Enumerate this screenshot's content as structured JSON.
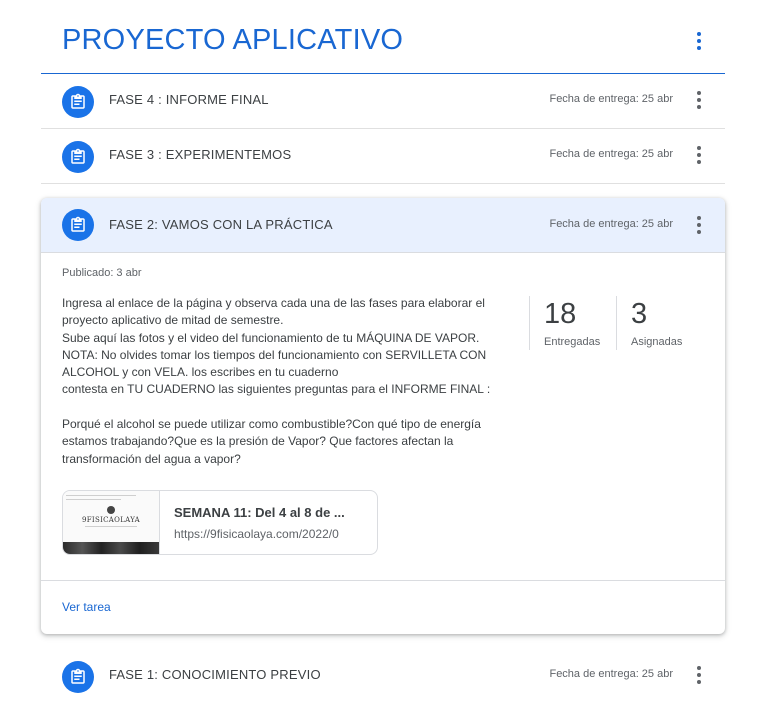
{
  "topic": {
    "title": "PROYECTO APLICATIVO"
  },
  "assignments": [
    {
      "title": "FASE 4 : INFORME FINAL",
      "due": "Fecha de entrega: 25 abr"
    },
    {
      "title": "FASE 3 : EXPERIMENTEMOS",
      "due": "Fecha de entrega: 25 abr"
    },
    {
      "title": "FASE 2: VAMOS CON LA PRÁCTICA",
      "due": "Fecha de entrega: 25 abr"
    },
    {
      "title": "FASE 1: CONOCIMIENTO PREVIO",
      "due": "Fecha de entrega: 25 abr"
    }
  ],
  "expanded": {
    "published": "Publicado: 3 abr",
    "description_lines": [
      "Ingresa al enlace de la página y observa cada una de las fases para elaborar el",
      "proyecto aplicativo de mitad de semestre.",
      "Sube aquí las fotos y el video del funcionamiento de tu MÁQUINA DE VAPOR.",
      "NOTA: No olvides tomar los tiempos del funcionamiento con SERVILLETA CON",
      "ALCOHOL y con VELA. los escribes en tu cuaderno",
      "contesta en TU CUADERNO las siguientes preguntas para el INFORME FINAL :",
      "",
      "Porqué el alcohol se puede utilizar como combustible?Con qué tipo de energía",
      "estamos trabajando?Que es la presión de Vapor? Que factores afectan la",
      "transformación del agua a vapor?"
    ],
    "stats": {
      "turned_in": {
        "value": "18",
        "label": "Entregadas"
      },
      "assigned": {
        "value": "3",
        "label": "Asignadas"
      }
    },
    "attachment": {
      "title": "SEMANA 11: Del 4 al 8 de ...",
      "url": "https://9fisicaolaya.com/2022/0",
      "thumb_text": "9FISICAOLAYA"
    },
    "view_link": "Ver tarea"
  },
  "colors": {
    "accent": "#1967d2",
    "icon_bg": "#1a73e8",
    "expanded_header_bg": "#e8f0fe"
  },
  "icons": {
    "assignment": "assignment-icon",
    "more": "more-vert-icon"
  }
}
